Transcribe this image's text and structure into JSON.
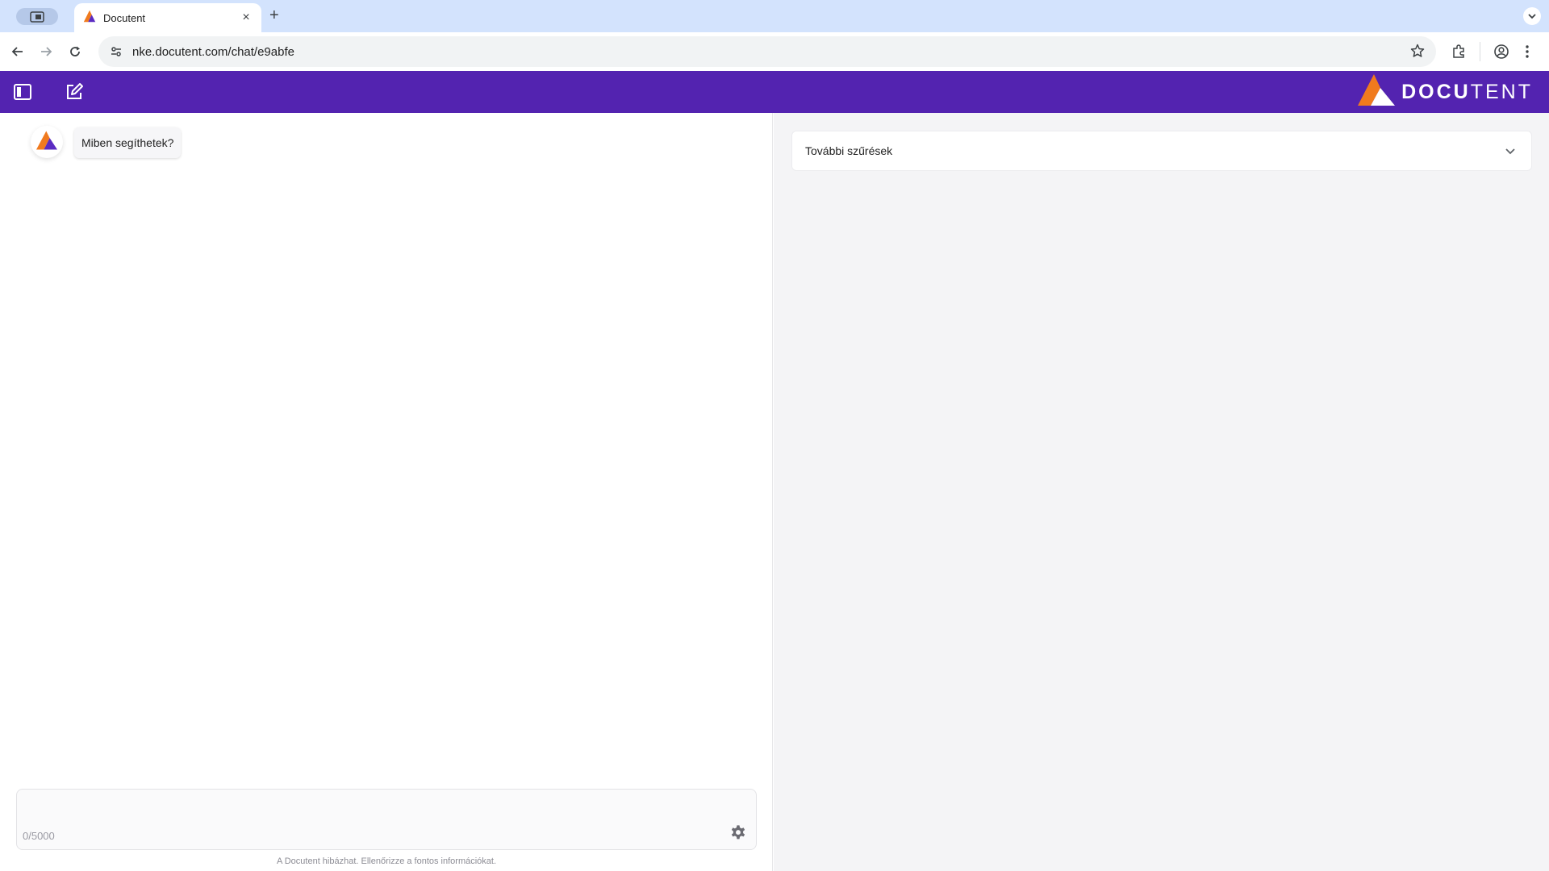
{
  "browser": {
    "tab_title": "Docutent",
    "tab_close": "×",
    "new_tab": "+",
    "url": "nke.docutent.com/chat/e9abfe"
  },
  "header": {
    "brand_bold": "DOCU",
    "brand_light": "TENT",
    "colors": {
      "bar": "#5323b0",
      "logo_orange": "#f07a1e",
      "logo_violet": "#5a2bc2"
    }
  },
  "chat": {
    "messages": [
      {
        "role": "bot",
        "text": "Miben segíthetek?"
      }
    ],
    "char_count": "0/5000",
    "disclaimer": "A Docutent hibázhat. Ellenőrizze a fontos információkat."
  },
  "filters": {
    "label": "További szűrések"
  }
}
